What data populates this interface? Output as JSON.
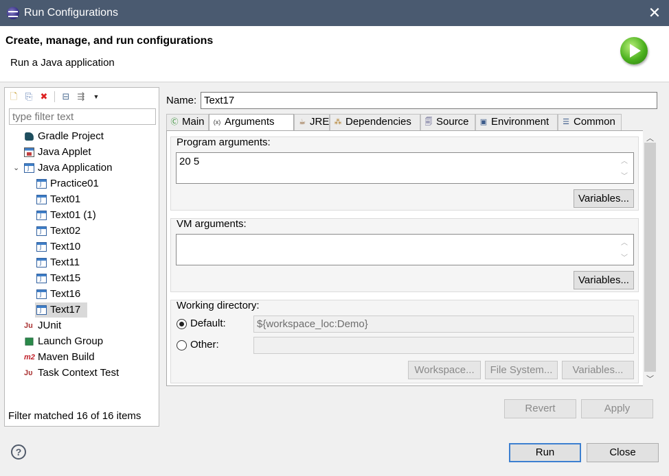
{
  "window": {
    "title": "Run Configurations",
    "close_glyph": "✕"
  },
  "header": {
    "title": "Create, manage, and run configurations",
    "subtitle": "Run a Java application"
  },
  "left": {
    "filter_placeholder": "type filter text",
    "toolbar": [
      {
        "name": "new-launch-config-icon",
        "glyph": "🗋"
      },
      {
        "name": "duplicate-icon",
        "glyph": "⎘"
      },
      {
        "name": "delete-icon",
        "glyph": "✖"
      },
      {
        "name": "collapse-all-icon",
        "glyph": "⊟"
      },
      {
        "name": "filter-icon",
        "glyph": "⇶"
      },
      {
        "name": "dropdown-arrow-icon",
        "glyph": "▼"
      }
    ],
    "tree": [
      {
        "label": "Gradle Project",
        "icon": "gradle-icon"
      },
      {
        "label": "Java Applet",
        "icon": "applet-icon"
      },
      {
        "label": "Java Application",
        "icon": "java-app-icon",
        "expanded": true
      },
      {
        "label": "Practice01",
        "icon": "java-file-icon"
      },
      {
        "label": "Text01",
        "icon": "java-file-icon"
      },
      {
        "label": "Text01 (1)",
        "icon": "java-file-icon"
      },
      {
        "label": "Text02",
        "icon": "java-file-icon"
      },
      {
        "label": "Text10",
        "icon": "java-file-icon"
      },
      {
        "label": "Text11",
        "icon": "java-file-icon"
      },
      {
        "label": "Text15",
        "icon": "java-file-icon"
      },
      {
        "label": "Text16",
        "icon": "java-file-icon"
      },
      {
        "label": "Text17",
        "icon": "java-file-icon",
        "selected": true
      },
      {
        "label": "JUnit",
        "icon": "junit-icon"
      },
      {
        "label": "Launch Group",
        "icon": "launch-group-icon"
      },
      {
        "label": "Maven Build",
        "icon": "maven-icon"
      },
      {
        "label": "Task Context Test",
        "icon": "task-context-icon"
      }
    ],
    "status": "Filter matched 16 of 16 items"
  },
  "config": {
    "name_label": "Name:",
    "name_value": "Text17",
    "tabs": [
      {
        "label": "Main",
        "icon": "main-tab-icon",
        "glyph": "Ⓒ"
      },
      {
        "label": "Arguments",
        "icon": "arguments-tab-icon",
        "glyph": "(x)",
        "active": true
      },
      {
        "label": "JRE",
        "icon": "jre-tab-icon",
        "glyph": "☕"
      },
      {
        "label": "Dependencies",
        "icon": "dependencies-tab-icon",
        "glyph": "⁂"
      },
      {
        "label": "Source",
        "icon": "source-tab-icon",
        "glyph": "🗐"
      },
      {
        "label": "Environment",
        "icon": "environment-tab-icon",
        "glyph": "▣"
      },
      {
        "label": "Common",
        "icon": "common-tab-icon",
        "glyph": "☰"
      }
    ],
    "program_args": {
      "label": "Program arguments:",
      "value": "20 5",
      "variables": "Variables..."
    },
    "vm_args": {
      "label": "VM arguments:",
      "value": "",
      "variables": "Variables..."
    },
    "working_dir": {
      "label": "Working directory:",
      "default_label": "Default:",
      "default_value": "${workspace_loc:Demo}",
      "other_label": "Other:",
      "other_value": "",
      "workspace": "Workspace...",
      "filesystem": "File System...",
      "variables": "Variables..."
    }
  },
  "buttons": {
    "revert": "Revert",
    "apply": "Apply",
    "run": "Run",
    "close": "Close",
    "help": "?"
  }
}
